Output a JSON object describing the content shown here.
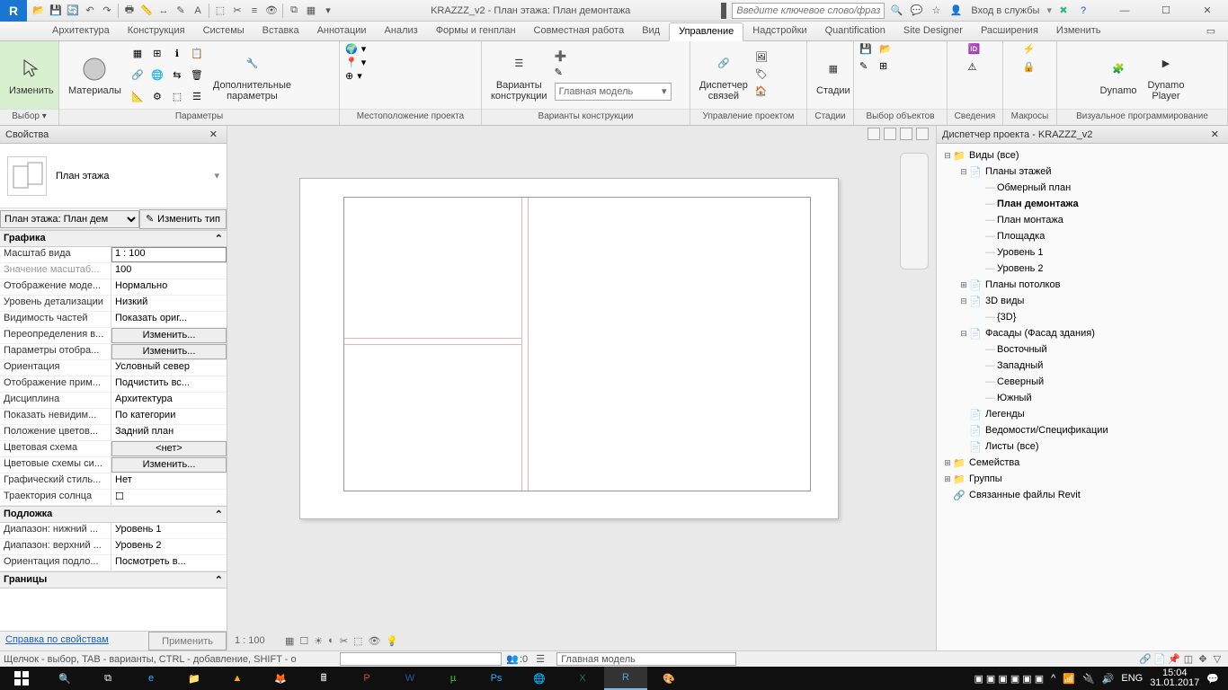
{
  "title": "KRAZZZ_v2 - План этажа: План демонтажа",
  "search_placeholder": "Введите ключевое слово/фразу",
  "login": "Вход в службы",
  "tabs": [
    "Архитектура",
    "Конструкция",
    "Системы",
    "Вставка",
    "Аннотации",
    "Анализ",
    "Формы и генплан",
    "Совместная работа",
    "Вид",
    "Управление",
    "Надстройки",
    "Quantification",
    "Site Designer",
    "Расширения",
    "Изменить"
  ],
  "active_tab": "Управление",
  "ribbon": {
    "modify": {
      "label": "Изменить",
      "panel": "Выбор ▾"
    },
    "materials": {
      "label": "Материалы",
      "panel": "Параметры"
    },
    "addparams": {
      "label": "Дополнительные\nпараметры"
    },
    "location_panel": "Местоположение проекта",
    "designopt": {
      "label": "Варианты\nконструкции",
      "combo": "Главная модель",
      "panel": "Варианты конструкции"
    },
    "links": {
      "label": "Диспетчер\nсвязей",
      "panel": "Управление проектом"
    },
    "phases": {
      "label": "Стадии",
      "panel": "Стадии"
    },
    "selection_panel": "Выбор объектов",
    "info_panel": "Сведения",
    "macros_panel": "Макросы",
    "dynamo": {
      "label": "Dynamo"
    },
    "dynamo_player": {
      "label": "Dynamo\nPlayer"
    },
    "visual_panel": "Визуальное программирование"
  },
  "properties": {
    "title": "Свойства",
    "type": "План этажа",
    "instance": "План этажа: План дем",
    "edit_type": "Изменить тип",
    "groups": {
      "graphics": "Графика",
      "underlay": "Подложка",
      "extents": "Границы"
    },
    "rows": [
      {
        "n": "Масштаб вида",
        "v": "1 : 100",
        "input": true
      },
      {
        "n": "Значение масштаб...",
        "v": "100",
        "gray": true
      },
      {
        "n": "Отображение моде...",
        "v": "Нормально"
      },
      {
        "n": "Уровень детализации",
        "v": "Низкий"
      },
      {
        "n": "Видимость частей",
        "v": "Показать ориг..."
      },
      {
        "n": "Переопределения в...",
        "v": "Изменить...",
        "btn": true
      },
      {
        "n": "Параметры отобра...",
        "v": "Изменить...",
        "btn": true
      },
      {
        "n": "Ориентация",
        "v": "Условный север"
      },
      {
        "n": "Отображение прим...",
        "v": "Подчистить вс..."
      },
      {
        "n": "Дисциплина",
        "v": "Архитектура"
      },
      {
        "n": "Показать невидим...",
        "v": "По категории"
      },
      {
        "n": "Положение цветов...",
        "v": "Задний план"
      },
      {
        "n": "Цветовая схема",
        "v": "<нет>",
        "btn": true
      },
      {
        "n": "Цветовые схемы си...",
        "v": "Изменить...",
        "btn": true
      },
      {
        "n": "Графический стиль...",
        "v": "Нет"
      },
      {
        "n": "Траектория солнца",
        "v": "☐"
      }
    ],
    "underlay_rows": [
      {
        "n": "Диапазон: нижний ...",
        "v": "Уровень 1"
      },
      {
        "n": "Диапазон: верхний ...",
        "v": "Уровень 2"
      },
      {
        "n": "Ориентация подло...",
        "v": "Посмотреть в..."
      }
    ],
    "help_link": "Справка по свойствам",
    "apply": "Применить"
  },
  "browser": {
    "title": "Диспетчер проекта - KRAZZZ_v2",
    "tree": [
      {
        "d": 0,
        "e": "-",
        "l": "Виды (все)",
        "i": "views"
      },
      {
        "d": 1,
        "e": "-",
        "l": "Планы этажей"
      },
      {
        "d": 2,
        "l": "Обмерный план"
      },
      {
        "d": 2,
        "l": "План демонтажа",
        "sel": true
      },
      {
        "d": 2,
        "l": "План монтажа"
      },
      {
        "d": 2,
        "l": "Площадка"
      },
      {
        "d": 2,
        "l": "Уровень 1"
      },
      {
        "d": 2,
        "l": "Уровень 2"
      },
      {
        "d": 1,
        "e": "+",
        "l": "Планы потолков"
      },
      {
        "d": 1,
        "e": "-",
        "l": "3D виды"
      },
      {
        "d": 2,
        "l": "{3D}"
      },
      {
        "d": 1,
        "e": "-",
        "l": "Фасады (Фасад здания)"
      },
      {
        "d": 2,
        "l": "Восточный"
      },
      {
        "d": 2,
        "l": "Западный"
      },
      {
        "d": 2,
        "l": "Северный"
      },
      {
        "d": 2,
        "l": "Южный"
      },
      {
        "d": 1,
        "l": "Легенды",
        "i": "leg"
      },
      {
        "d": 1,
        "l": "Ведомости/Спецификации",
        "i": "sched"
      },
      {
        "d": 1,
        "l": "Листы (все)",
        "i": "sheet"
      },
      {
        "d": 0,
        "e": "+",
        "l": "Семейства",
        "i": "fam"
      },
      {
        "d": 0,
        "e": "+",
        "l": "Группы",
        "i": "grp"
      },
      {
        "d": 0,
        "l": "Связанные файлы Revit",
        "i": "link"
      }
    ]
  },
  "view_control_scale": "1 : 100",
  "status": {
    "hint": "Щелчок - выбор, TAB - варианты, CTRL - добавление, SHIFT - о",
    "worksets": "Главная модель",
    "zero": ":0"
  },
  "taskbar": {
    "lang": "ENG",
    "time": "15:04",
    "date": "31.01.2017"
  }
}
